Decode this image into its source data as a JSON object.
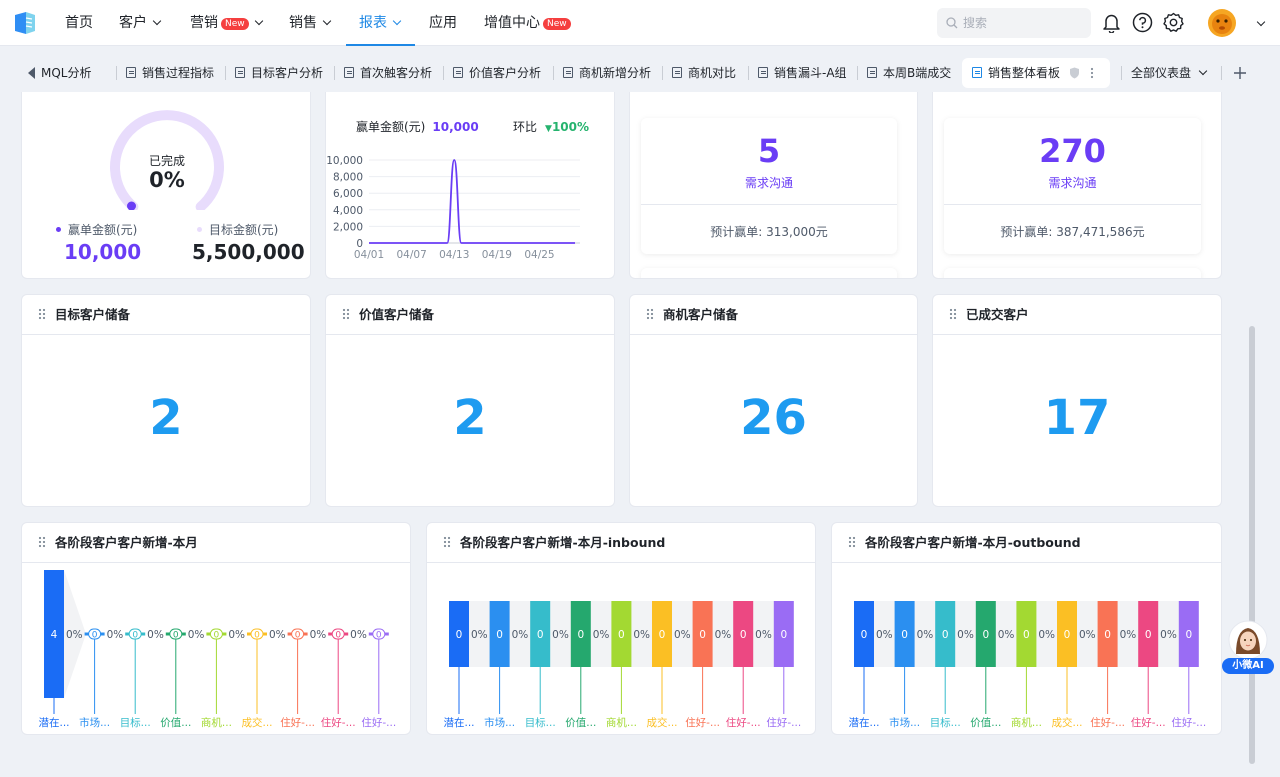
{
  "nav": {
    "items": [
      {
        "label": "首页"
      },
      {
        "label": "客户"
      },
      {
        "label": "营销",
        "badge": "New"
      },
      {
        "label": "销售"
      },
      {
        "label": "报表"
      },
      {
        "label": "应用"
      },
      {
        "label": "增值中心",
        "badge": "New"
      }
    ],
    "active": "报表",
    "search_placeholder": "搜索",
    "icons": [
      "bell-icon",
      "help-icon",
      "gear-icon",
      "avatar",
      "chevron-down-icon"
    ]
  },
  "tabs": {
    "items": [
      "MQL分析",
      "销售过程指标",
      "目标客户分析",
      "首次触客分析",
      "价值客户分析",
      "商机新增分析",
      "商机对比",
      "销售漏斗-A组",
      "本周B端成交",
      "销售整体看板"
    ],
    "active": "销售整体看板",
    "all_label": "全部仪表盘"
  },
  "gauge": {
    "completed_label": "已完成",
    "percent": "0%",
    "percent_value": 0,
    "won_label": "赢单金额(元)",
    "won_value": "10,000",
    "target_label": "目标金额(元)",
    "target_value": "5,500,000"
  },
  "trend": {
    "title": "赢单金额(元)",
    "value": "10,000",
    "ratio_label": "环比",
    "ratio_value": "100%"
  },
  "chart_data": [
    {
      "type": "line",
      "title": "赢单金额(元)",
      "x": [
        "04/01",
        "04/07",
        "04/13",
        "04/19",
        "04/25"
      ],
      "x_ticks": [
        "04/01",
        "04/07",
        "04/13",
        "04/19",
        "04/25"
      ],
      "y_ticks": [
        "10,000",
        "8,000",
        "6,000",
        "4,000",
        "2,000",
        "0"
      ],
      "ylim": [
        0,
        10000
      ],
      "series": [
        {
          "points": [
            [
              "04/01",
              0
            ],
            [
              "04/12",
              0
            ],
            [
              "04/13",
              10000
            ],
            [
              "04/14",
              0
            ],
            [
              "04/30",
              0
            ]
          ]
        }
      ],
      "color": "#6a3df5"
    }
  ],
  "stat_cards": [
    {
      "value": "5",
      "label": "需求沟通",
      "forecast": "预计赢单: 313,000元"
    },
    {
      "value": "270",
      "label": "需求沟通",
      "forecast": "预计赢单: 387,471,586元"
    }
  ],
  "reserve_cards": [
    {
      "title": "目标客户储备",
      "value": "2"
    },
    {
      "title": "价值客户储备",
      "value": "2"
    },
    {
      "title": "商机客户储备",
      "value": "26"
    },
    {
      "title": "已成交客户",
      "value": "17"
    }
  ],
  "funnels": [
    {
      "title": "各阶段客户客户新增-本月",
      "bars": [
        "4",
        "0",
        "0",
        "0",
        "0",
        "0",
        "0",
        "0",
        "0"
      ],
      "rates": [
        "0%",
        "0%",
        "0%",
        "0%",
        "0%",
        "0%",
        "0%",
        "0%"
      ],
      "stages": [
        "潜在...",
        "市场...",
        "目标...",
        "价值...",
        "商机...",
        "成交...",
        "住好-...",
        "住好-...",
        "住好-..."
      ]
    },
    {
      "title": "各阶段客户客户新增-本月-inbound",
      "bars": [
        "0",
        "0",
        "0",
        "0",
        "0",
        "0",
        "0",
        "0",
        "0"
      ],
      "rates": [
        "0%",
        "0%",
        "0%",
        "0%",
        "0%",
        "0%",
        "0%",
        "0%"
      ],
      "stages": [
        "潜在...",
        "市场...",
        "目标...",
        "价值...",
        "商机...",
        "成交...",
        "住好-...",
        "住好-...",
        "住好-..."
      ]
    },
    {
      "title": "各阶段客户客户新增-本月-outbound",
      "bars": [
        "0",
        "0",
        "0",
        "0",
        "0",
        "0",
        "0",
        "0",
        "0"
      ],
      "rates": [
        "0%",
        "0%",
        "0%",
        "0%",
        "0%",
        "0%",
        "0%",
        "0%"
      ],
      "stages": [
        "潜在...",
        "市场...",
        "目标...",
        "价值...",
        "商机...",
        "成交...",
        "住好-...",
        "住好-...",
        "住好-..."
      ]
    }
  ],
  "stage_colors": [
    "#1a6cf5",
    "#2b8ff0",
    "#36bccb",
    "#25a86e",
    "#a3d932",
    "#fbbf24",
    "#f97355",
    "#ec4882",
    "#9a6cf4"
  ],
  "assistant": {
    "label": "小微AI"
  }
}
